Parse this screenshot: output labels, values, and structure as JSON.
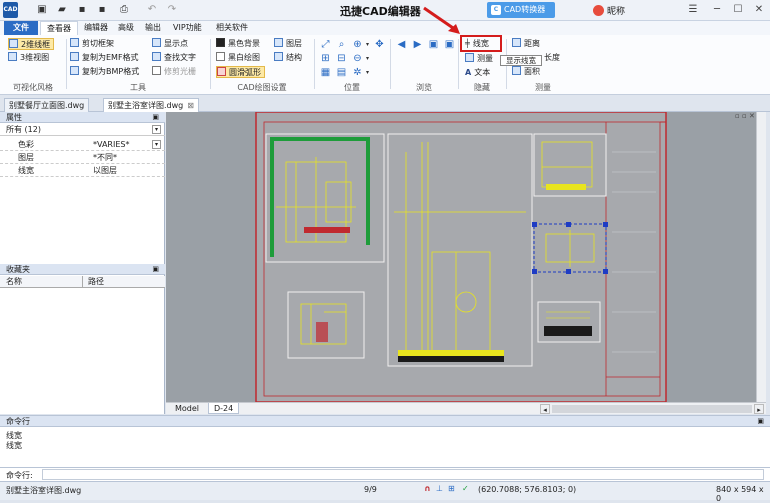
{
  "app": {
    "title": "迅捷CAD编辑器",
    "converter_label": "CAD转换器",
    "converter_icon_text": "C",
    "nickname": "昵称",
    "logo_text": "CAD"
  },
  "menu": {
    "tabs": [
      "文件",
      "查看器",
      "编辑器",
      "高级",
      "输出",
      "VIP功能",
      "相关软件"
    ],
    "active": "查看器"
  },
  "ribbon": {
    "visual_style": {
      "label": "可视化风格",
      "items": [
        "2维线框",
        "3维视图"
      ]
    },
    "tools": {
      "label": "工具",
      "items": [
        "剪切框架",
        "复制为EMF格式",
        "复制为BMP格式",
        "显示点",
        "查找文字",
        "修剪光栅"
      ]
    },
    "draw_settings": {
      "label": "CAD绘图设置",
      "items": [
        "黑色背景",
        "黑白绘图",
        "圆滑弧形",
        "图层",
        "结构"
      ]
    },
    "position": {
      "label": "位置"
    },
    "browse": {
      "label": "浏览"
    },
    "hide": {
      "label": "隐藏",
      "items": [
        "线宽",
        "测量",
        "文本"
      ]
    },
    "measure": {
      "label": "测量",
      "items": [
        "距离",
        "长度",
        "面积"
      ]
    },
    "tooltip": "显示线宽"
  },
  "doc_tabs": [
    "别墅餐厅立面图.dwg",
    "别墅主浴室详图.dwg"
  ],
  "properties": {
    "title": "属性",
    "selector": "所有 (12)",
    "rows": [
      {
        "key": "色彩",
        "value": "*VARIES*"
      },
      {
        "key": "图层",
        "value": "*不同*"
      },
      {
        "key": "线宽",
        "value": "以图层"
      }
    ]
  },
  "favorites": {
    "title": "收藏夹",
    "columns": [
      "名称",
      "路径"
    ]
  },
  "layout_tabs": [
    "Model",
    "D-24"
  ],
  "command": {
    "title": "命令行",
    "lines": [
      "线宽",
      "线宽"
    ],
    "prompt": "命令行:"
  },
  "status": {
    "file": "别墅主浴室详图.dwg",
    "page": "9/9",
    "coords": "(620.7088; 576.8103; 0)",
    "size": "840 x 594 x 0"
  }
}
